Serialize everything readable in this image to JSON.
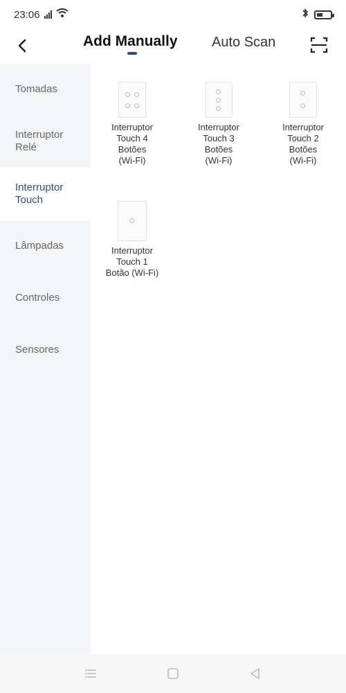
{
  "status_bar": {
    "time": "23:06",
    "signal_label": "ııll",
    "icons": [
      "signal-icon",
      "wifi-icon",
      "bluetooth-icon",
      "battery-icon"
    ]
  },
  "header": {
    "tab_active": "Add Manually",
    "tab_inactive": "Auto Scan",
    "back_icon": "chevron-left-icon",
    "scan_icon": "scan-icon"
  },
  "sidebar": {
    "items": [
      {
        "label": "Tomadas"
      },
      {
        "label": "Interruptor\nRelé"
      },
      {
        "label": "Interruptor\nTouch"
      },
      {
        "label": "Lâmpadas"
      },
      {
        "label": "Controles"
      },
      {
        "label": "Sensores"
      }
    ],
    "active_index": 2
  },
  "products": [
    {
      "name": "Interruptor\nTouch 4\nBotões\n(Wi-Fi)"
    },
    {
      "name": "Interruptor\nTouch 3\nBotões\n(Wi-Fi)"
    },
    {
      "name": "Interruptor\nTouch 2\nBotões\n(Wi-Fi)"
    },
    {
      "name": "Interruptor\nTouch 1\nBotão (Wi-Fi)"
    }
  ],
  "colors": {
    "accent": "#1d4fa3",
    "active_sidebar_text": "#2b4d87",
    "sidebar_bg": "#f4f5f7"
  },
  "nav_icons": [
    "menu-icon",
    "home-icon",
    "back-triangle-icon"
  ]
}
